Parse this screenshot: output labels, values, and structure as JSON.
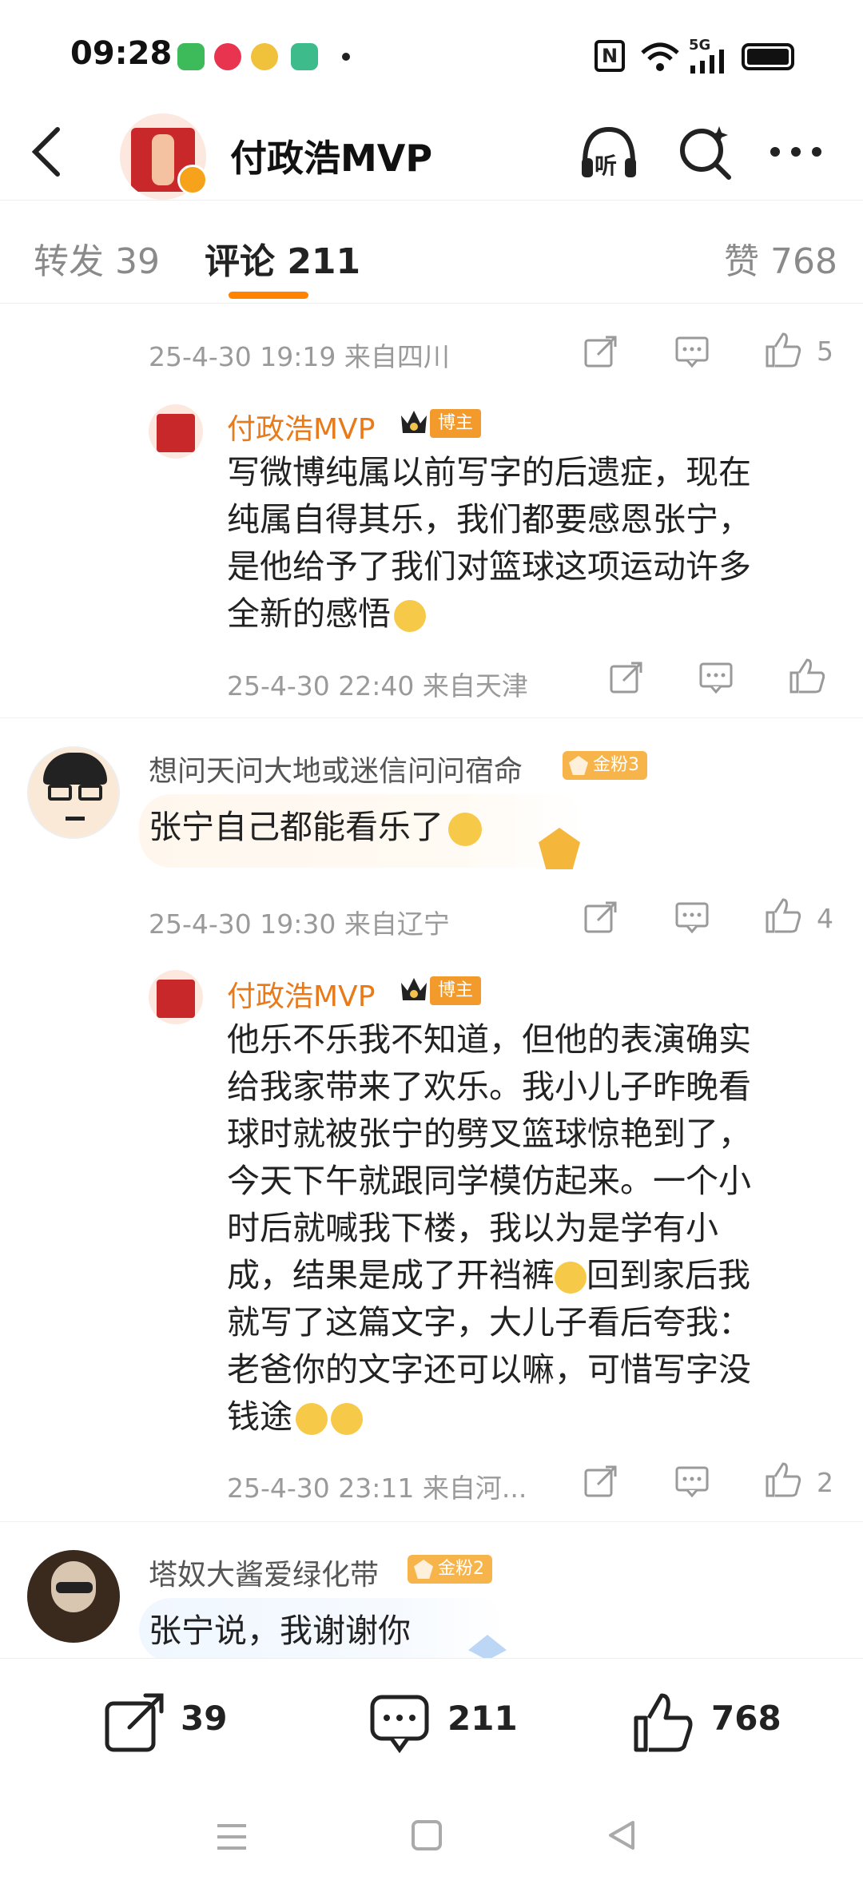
{
  "status": {
    "time": "09:28",
    "network": "5G"
  },
  "header": {
    "title": "付政浩MVP",
    "listen_label": "听"
  },
  "tabs": {
    "repost": "转发 39",
    "comments": "评论 211",
    "likes": "赞 768"
  },
  "badges": {
    "blogger": "博主",
    "fan3": "金粉3",
    "fan2": "金粉2"
  },
  "comments": [
    {
      "meta": "25-4-30 19:19 来自四川",
      "likes": "5"
    },
    {
      "author": "付政浩MVP",
      "lines": [
        "写微博纯属以前写字的后遗症，现在",
        "纯属自得其乐，我们都要感恩张宁，",
        "是他给予了我们对篮球这项运动许多",
        "全新的感悟"
      ],
      "meta": "25-4-30 22:40 来自天津"
    },
    {
      "author": "想问天问大地或迷信问问宿命",
      "text": "张宁自己都能看乐了",
      "meta": "25-4-30 19:30 来自辽宁",
      "likes": "4"
    },
    {
      "author": "付政浩MVP",
      "lines": [
        "他乐不乐我不知道，但他的表演确实",
        "给我家带来了欢乐。我小儿子昨晚看",
        "球时就被张宁的劈叉篮球惊艳到了，",
        "今天下午就跟同学模仿起来。一个小",
        "时后就喊我下楼，我以为是学有小",
        "成，结果是成了开裆裤",
        "就写了这篇文字，大儿子看后夸我：",
        "老爸你的文字还可以嘛，可惜写字没",
        "钱途"
      ],
      "line6_suffix": "回到家后我",
      "meta": "25-4-30 23:11 来自河...",
      "likes": "2"
    },
    {
      "author": "塔奴大酱爱绿化带",
      "text": "张宁说，我谢谢你"
    }
  ],
  "bottom": {
    "reposts": "39",
    "comments": "211",
    "likes": "768"
  },
  "colors": {
    "accent": "#ff8200",
    "author": "#e87a1a",
    "meta": "#9a9a9a"
  },
  "icons": [
    "back-arrow-icon",
    "headphone-icon",
    "search-icon",
    "more-icon",
    "share-icon",
    "comment-icon",
    "thumb-up-icon",
    "crown-icon",
    "emoji-666-icon",
    "grin-emoji-icon",
    "laugh-cry-emoji-icon",
    "menu-icon",
    "home-icon",
    "back-triangle-icon"
  ]
}
